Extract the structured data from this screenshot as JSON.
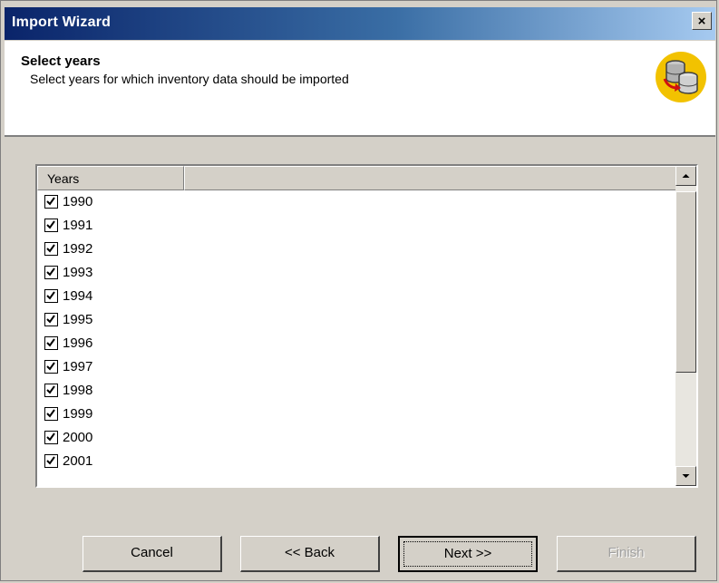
{
  "window": {
    "title": "Import Wizard",
    "close_glyph": "×"
  },
  "header": {
    "title": "Select years",
    "description": "Select years for which inventory data should be imported",
    "icon": "database-import-icon"
  },
  "list": {
    "columns": [
      "Years",
      ""
    ],
    "rows": [
      {
        "label": "1990",
        "checked": true
      },
      {
        "label": "1991",
        "checked": true
      },
      {
        "label": "1992",
        "checked": true
      },
      {
        "label": "1993",
        "checked": true
      },
      {
        "label": "1994",
        "checked": true
      },
      {
        "label": "1995",
        "checked": true
      },
      {
        "label": "1996",
        "checked": true
      },
      {
        "label": "1997",
        "checked": true
      },
      {
        "label": "1998",
        "checked": true
      },
      {
        "label": "1999",
        "checked": true
      },
      {
        "label": "2000",
        "checked": true
      },
      {
        "label": "2001",
        "checked": true
      }
    ]
  },
  "buttons": {
    "cancel": "Cancel",
    "back": "<< Back",
    "next": "Next >>",
    "finish": "Finish"
  },
  "colors": {
    "title_bar_start": "#0a246a",
    "icon_background": "#f2c200",
    "dialog_face": "#d4d0c8"
  }
}
